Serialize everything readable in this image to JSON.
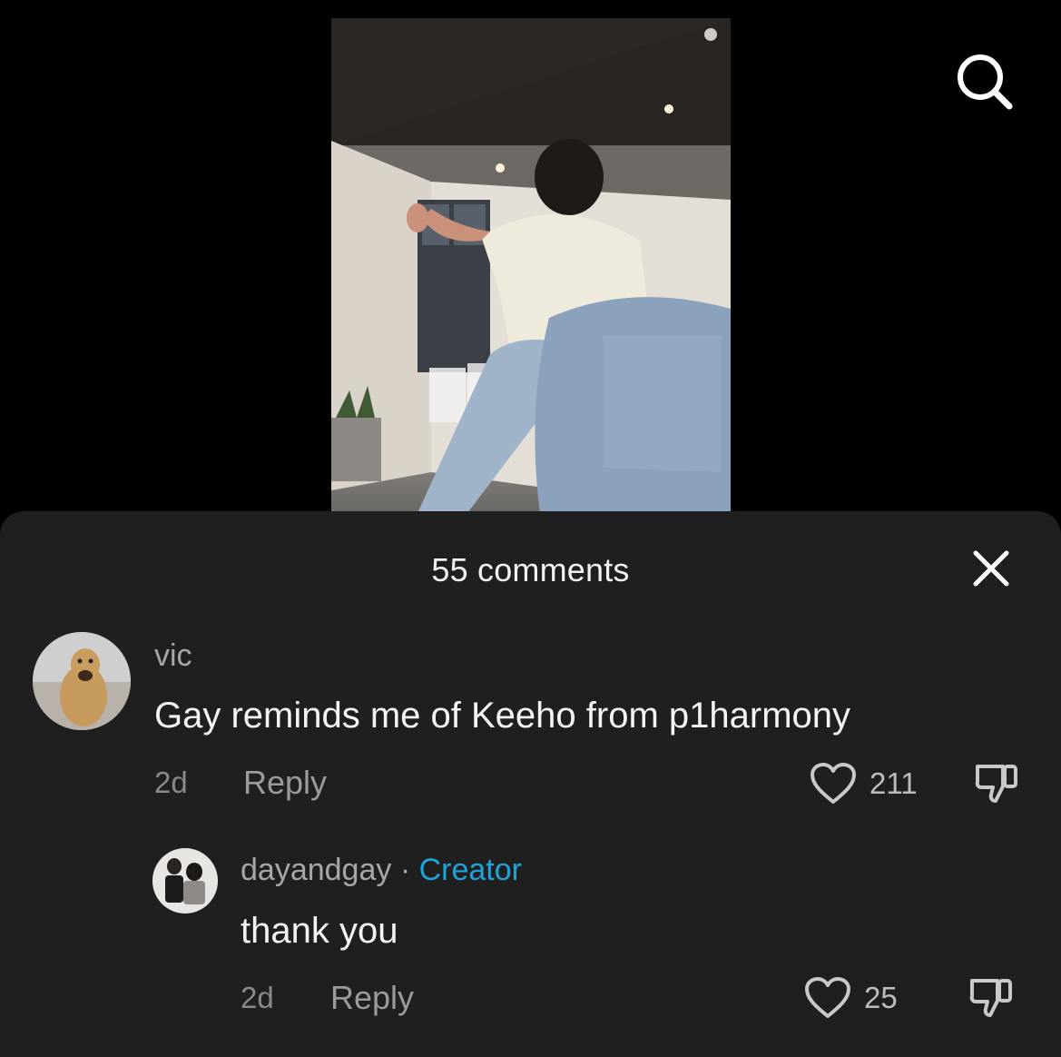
{
  "sheet": {
    "title": "55 comments"
  },
  "icons": {
    "search": "search-icon",
    "close": "close-icon",
    "like": "heart-icon",
    "dislike": "thumbs-down-icon"
  },
  "comments": [
    {
      "username": "vic",
      "text": "Gay reminds me of Keeho from p1harmony",
      "time": "2d",
      "reply_label": "Reply",
      "likes": "211"
    }
  ],
  "replies": [
    {
      "username": "dayandgay",
      "separator": "·",
      "badge": "Creator",
      "text": "thank you",
      "time": "2d",
      "reply_label": "Reply",
      "likes": "25"
    }
  ],
  "colors": {
    "sheet_bg": "#1f1f1f",
    "creator_badge": "#20a4d8"
  }
}
